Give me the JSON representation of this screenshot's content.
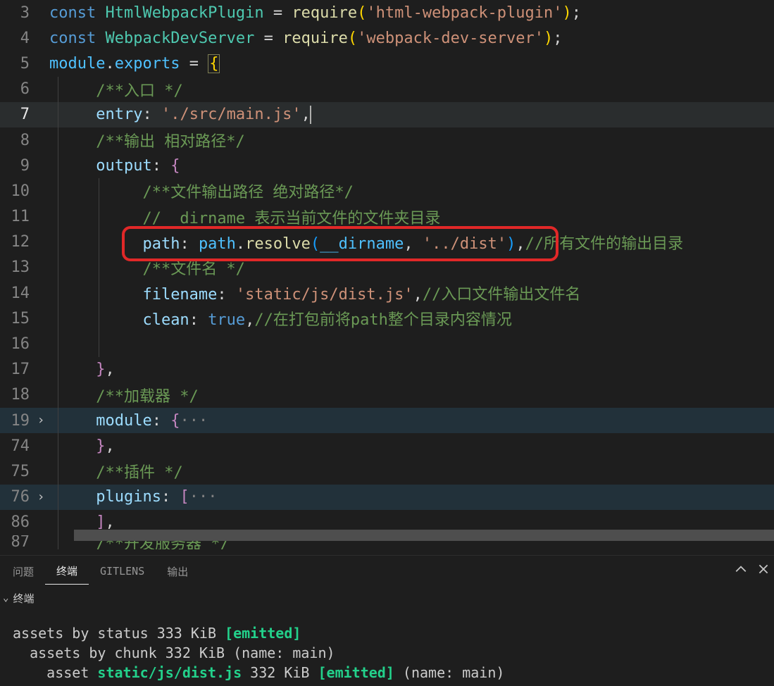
{
  "lines": [
    {
      "n": "3"
    },
    {
      "n": "4"
    },
    {
      "n": "5"
    },
    {
      "n": "6"
    },
    {
      "n": "7"
    },
    {
      "n": "8"
    },
    {
      "n": "9"
    },
    {
      "n": "10"
    },
    {
      "n": "11"
    },
    {
      "n": "12"
    },
    {
      "n": "13"
    },
    {
      "n": "14"
    },
    {
      "n": "15"
    },
    {
      "n": "16"
    },
    {
      "n": "17"
    },
    {
      "n": "18"
    },
    {
      "n": "19"
    },
    {
      "n": "74"
    },
    {
      "n": "75"
    },
    {
      "n": "76"
    },
    {
      "n": "86"
    },
    {
      "n": "87"
    }
  ],
  "tokens": {
    "const": "const",
    "require_fn": "require",
    "html_plugin": "HtmlWebpackPlugin",
    "html_plugin_str": "'html-webpack-plugin'",
    "dev_server": "WebpackDevServer",
    "dev_server_str": "'webpack-dev-server'",
    "module": "module",
    "exports": "exports",
    "eq": " = ",
    "entry_key": "entry",
    "entry_val": "'./src/main.js'",
    "output_key": "output",
    "path_key": "path",
    "path_obj": "path",
    "resolve_fn": "resolve",
    "dirname": "__dirname",
    "dist_str": "'../dist'",
    "filename_key": "filename",
    "filename_val": "'static/js/dist.js'",
    "clean_key": "clean",
    "true_kw": "true",
    "module_key": "module",
    "plugins_key": "plugins",
    "cmt_entry": "/**入口 */",
    "cmt_output": "/**输出 相对路径*/",
    "cmt_file_out": "/**文件输出路径 绝对路径*/",
    "cmt_dirname": "//  dirname 表示当前文件的文件夹目录",
    "cmt_all_out": "//所有文件的输出目录",
    "cmt_filename": "/**文件名 */",
    "cmt_entry_out": "//入口文件输出文件名",
    "cmt_clean": "//在打包前将path整个目录内容情况",
    "cmt_loader": "/**加载器 */",
    "cmt_plugins": "/**插件 */",
    "cmt_devserver": "/**开发服务器 */",
    "dots": "···",
    "semi": ";",
    "paren_o": "(",
    "paren_c": ")",
    "brace_o": "{",
    "brace_c": "}",
    "bracket_o": "[",
    "bracket_c": "]",
    "comma": ",",
    "dot": ".",
    "colon": ":"
  },
  "panel": {
    "tabs": [
      "问题",
      "终端",
      "GITLENS",
      "输出"
    ],
    "active_index": 1,
    "sub_label": "终端"
  },
  "terminal": {
    "l1_a": "assets by status 333 KiB ",
    "l1_b": "[emitted]",
    "l2": "  assets by chunk 332 KiB (name: main)",
    "l3_a": "    asset ",
    "l3_b": "static/js/dist.js",
    "l3_c": " 332 KiB ",
    "l3_d": "[emitted]",
    "l3_e": " (name: main)"
  }
}
